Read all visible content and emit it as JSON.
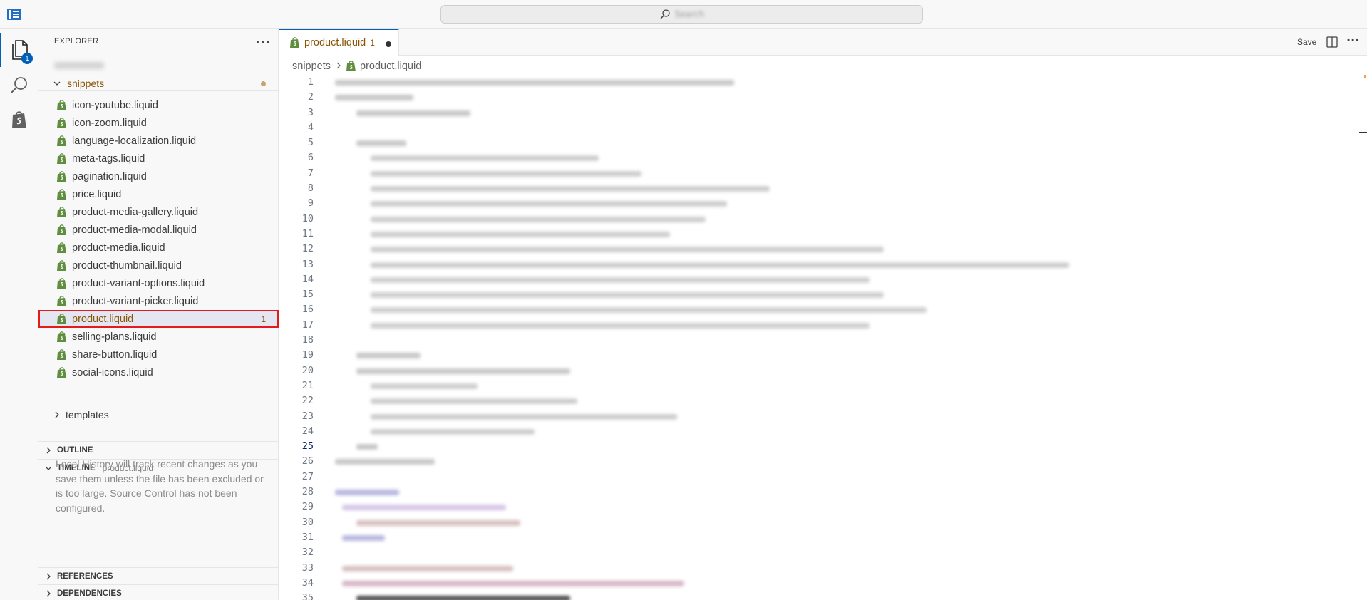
{
  "titlebar": {
    "search_placeholder": "Search"
  },
  "activity": {
    "explorer_badge": "1"
  },
  "sidebar": {
    "title": "EXPLORER",
    "more": "···",
    "folder": "snippets",
    "files": [
      {
        "name": "icon-youtube.liquid"
      },
      {
        "name": "icon-zoom.liquid"
      },
      {
        "name": "language-localization.liquid"
      },
      {
        "name": "meta-tags.liquid"
      },
      {
        "name": "pagination.liquid"
      },
      {
        "name": "price.liquid"
      },
      {
        "name": "product-media-gallery.liquid"
      },
      {
        "name": "product-media-modal.liquid"
      },
      {
        "name": "product-media.liquid"
      },
      {
        "name": "product-thumbnail.liquid"
      },
      {
        "name": "product-variant-options.liquid"
      },
      {
        "name": "product-variant-picker.liquid"
      },
      {
        "name": "product.liquid",
        "badge": "1"
      },
      {
        "name": "selling-plans.liquid"
      },
      {
        "name": "share-button.liquid"
      },
      {
        "name": "social-icons.liquid"
      }
    ],
    "templates_folder": "templates",
    "outline": "OUTLINE",
    "timeline": "TIMELINE",
    "timeline_file": "product.liquid",
    "timeline_message": "Local History will track recent changes as you save them unless the file has been excluded or is too large. Source Control has not been configured.",
    "references": "REFERENCES",
    "dependencies": "DEPENDENCIES"
  },
  "editor": {
    "tab_label": "product.liquid",
    "tab_problems": "1",
    "save_label": "Save",
    "breadcrumb_folder": "snippets",
    "breadcrumb_file": "product.liquid",
    "line_numbers": [
      "1",
      "2",
      "3",
      "4",
      "5",
      "6",
      "7",
      "8",
      "9",
      "10",
      "11",
      "12",
      "13",
      "14",
      "15",
      "16",
      "17",
      "18",
      "19",
      "20",
      "21",
      "22",
      "23",
      "24",
      "25",
      "26",
      "27",
      "28",
      "29",
      "30",
      "31",
      "32",
      "33",
      "34",
      "35"
    ],
    "current_line": "25"
  },
  "colors": {
    "accent": "#005fb8",
    "modified": "#895503",
    "shopify_green": "#5e8e3e",
    "selection_outline": "#e51b1b"
  }
}
